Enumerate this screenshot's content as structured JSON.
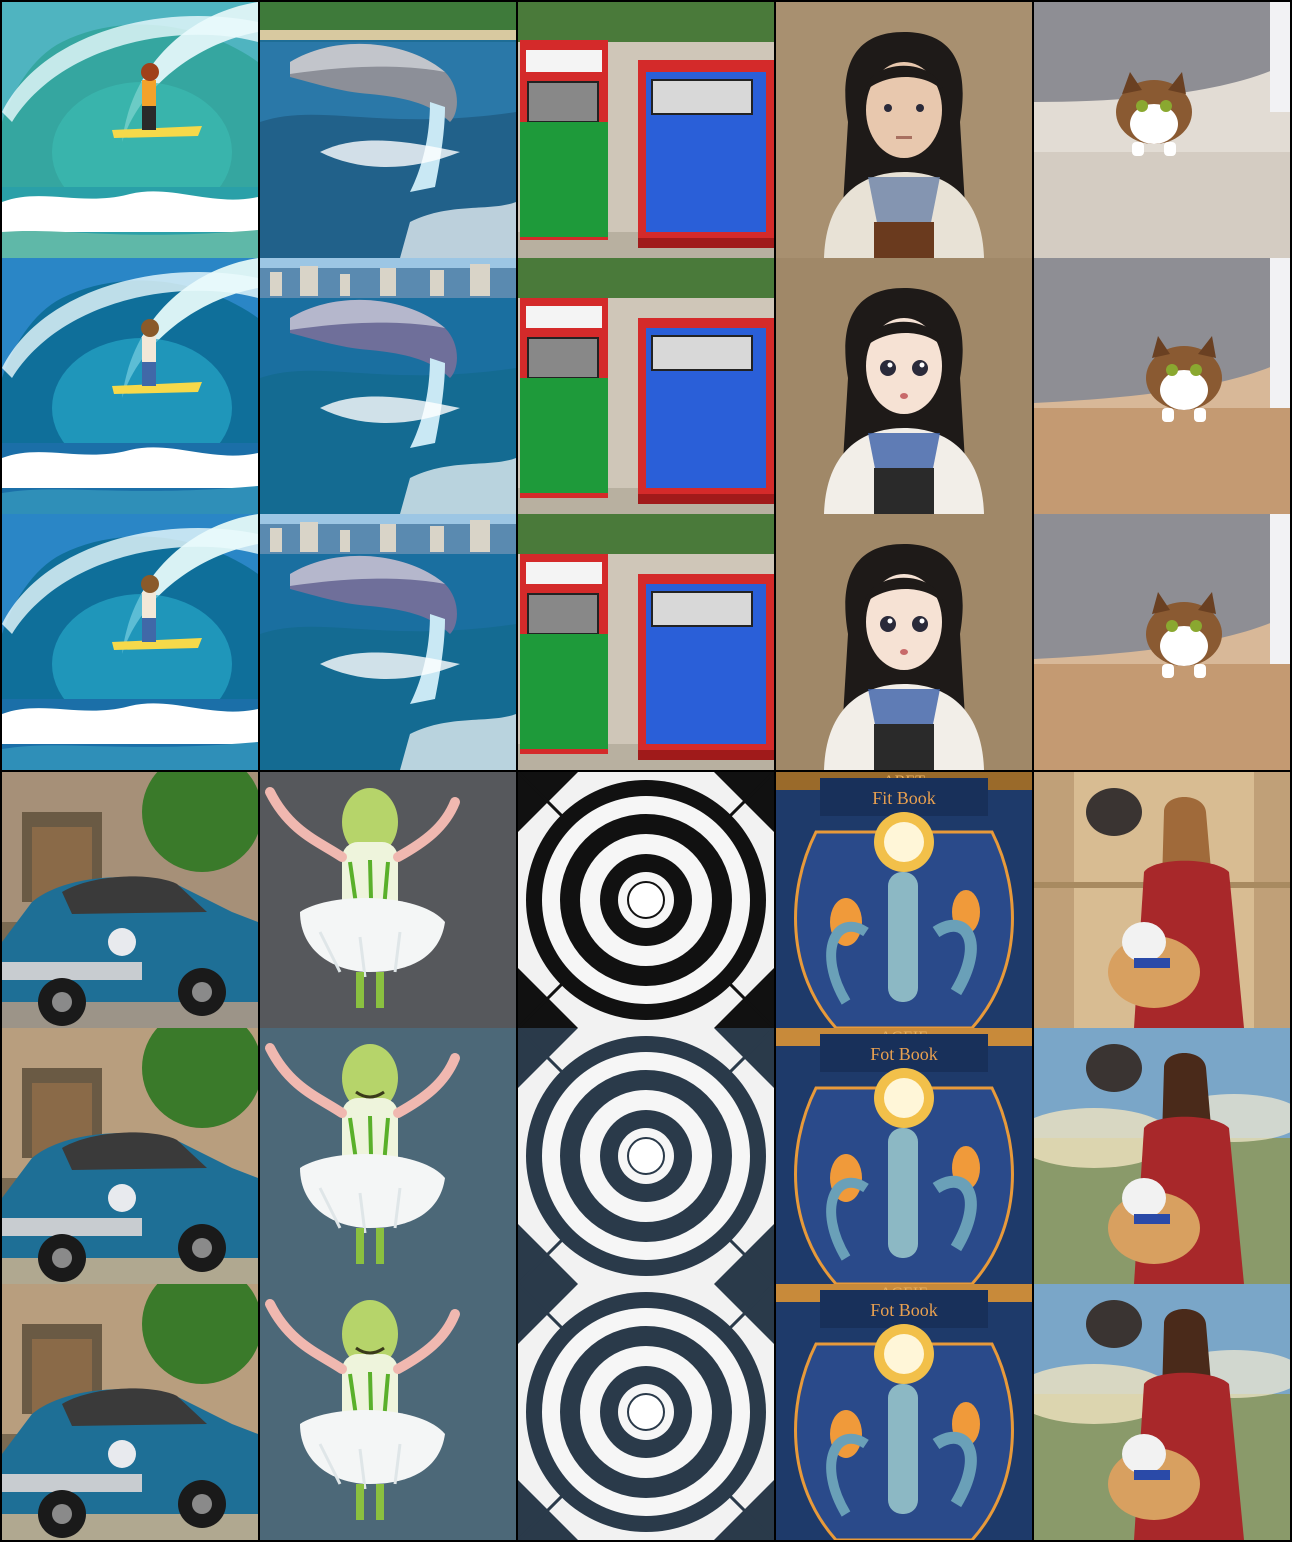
{
  "grid": {
    "columns": 5,
    "rows": 6,
    "background": "#000000",
    "tiles": [
      {
        "subject": "surfer-photo",
        "style": "photo"
      },
      {
        "subject": "dolphin",
        "style": "photo"
      },
      {
        "subject": "mailboxes",
        "style": "photo"
      },
      {
        "subject": "girl-portrait",
        "style": "photo"
      },
      {
        "subject": "cat-under-sofa",
        "style": "photo"
      },
      {
        "subject": "surfer-photo",
        "style": "anime"
      },
      {
        "subject": "dolphin",
        "style": "anime"
      },
      {
        "subject": "mailboxes",
        "style": "anime"
      },
      {
        "subject": "girl-portrait",
        "style": "anime"
      },
      {
        "subject": "cat-under-sofa",
        "style": "anime"
      },
      {
        "subject": "surfer-photo",
        "style": "anime"
      },
      {
        "subject": "dolphin",
        "style": "anime"
      },
      {
        "subject": "mailboxes",
        "style": "anime"
      },
      {
        "subject": "girl-portrait",
        "style": "anime"
      },
      {
        "subject": "cat-under-sofa",
        "style": "anime"
      },
      {
        "subject": "blue-car",
        "style": "photo"
      },
      {
        "subject": "onion-ballerina",
        "style": "photo"
      },
      {
        "subject": "concentric-rings",
        "style": "photo"
      },
      {
        "subject": "book-cover",
        "style": "photo",
        "cover_text": "Fit Book",
        "top_text": "ABET"
      },
      {
        "subject": "girl-with-dog",
        "style": "photo"
      },
      {
        "subject": "blue-car",
        "style": "anime"
      },
      {
        "subject": "onion-ballerina",
        "style": "anime"
      },
      {
        "subject": "concentric-rings",
        "style": "anime"
      },
      {
        "subject": "book-cover",
        "style": "anime",
        "cover_text": "Fot Book",
        "top_text": "AGEIE"
      },
      {
        "subject": "girl-with-dog",
        "style": "anime"
      },
      {
        "subject": "blue-car",
        "style": "anime"
      },
      {
        "subject": "onion-ballerina",
        "style": "anime"
      },
      {
        "subject": "concentric-rings",
        "style": "anime"
      },
      {
        "subject": "book-cover",
        "style": "anime",
        "cover_text": "Fot Book",
        "top_text": "AGEIE"
      },
      {
        "subject": "girl-with-dog",
        "style": "anime"
      }
    ]
  }
}
